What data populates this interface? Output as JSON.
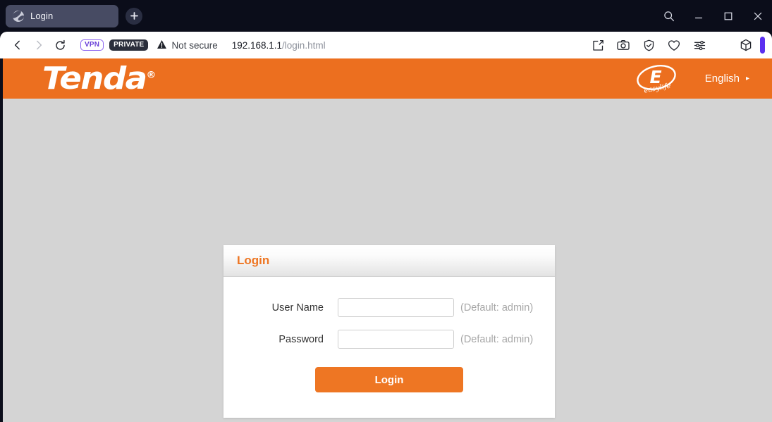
{
  "browser": {
    "tab": {
      "title": "Login",
      "favicon": "globe-icon"
    },
    "new_tab_label": "+",
    "window_controls": [
      {
        "name": "search-icon",
        "glyph": "⌕"
      },
      {
        "name": "minimize-icon",
        "glyph": "—"
      },
      {
        "name": "maximize-icon",
        "glyph": "□"
      },
      {
        "name": "close-icon",
        "glyph": "✕"
      }
    ],
    "nav": {
      "back": "‹",
      "forward": "›",
      "reload": "⟳"
    },
    "badges": {
      "vpn": "VPN",
      "private": "PRIVATE"
    },
    "security": {
      "warning_icon": "warning-triangle-icon",
      "label": "Not secure"
    },
    "url": {
      "host": "192.168.1.1",
      "path": "/login.html"
    },
    "toolbar_icons": [
      {
        "name": "edit-note-icon"
      },
      {
        "name": "camera-icon"
      },
      {
        "name": "shield-check-icon"
      },
      {
        "name": "heart-icon"
      },
      {
        "name": "sliders-icon"
      },
      {
        "name": "cube-icon"
      }
    ]
  },
  "site": {
    "brand": "Tenda",
    "brand_tm": "®",
    "easylife_logo": {
      "letter": "E",
      "wordmark": "easylife"
    },
    "language": {
      "label": "English",
      "caret": "▸"
    },
    "header_color": "#ec6f1f"
  },
  "login": {
    "panel_title": "Login",
    "fields": [
      {
        "label": "User Name",
        "value": "",
        "placeholder": "",
        "hint": "(Default: admin)",
        "type": "text"
      },
      {
        "label": "Password",
        "value": "",
        "placeholder": "",
        "hint": "(Default: admin)",
        "type": "password"
      }
    ],
    "submit_label": "Login",
    "accent_color": "#ee7623"
  }
}
